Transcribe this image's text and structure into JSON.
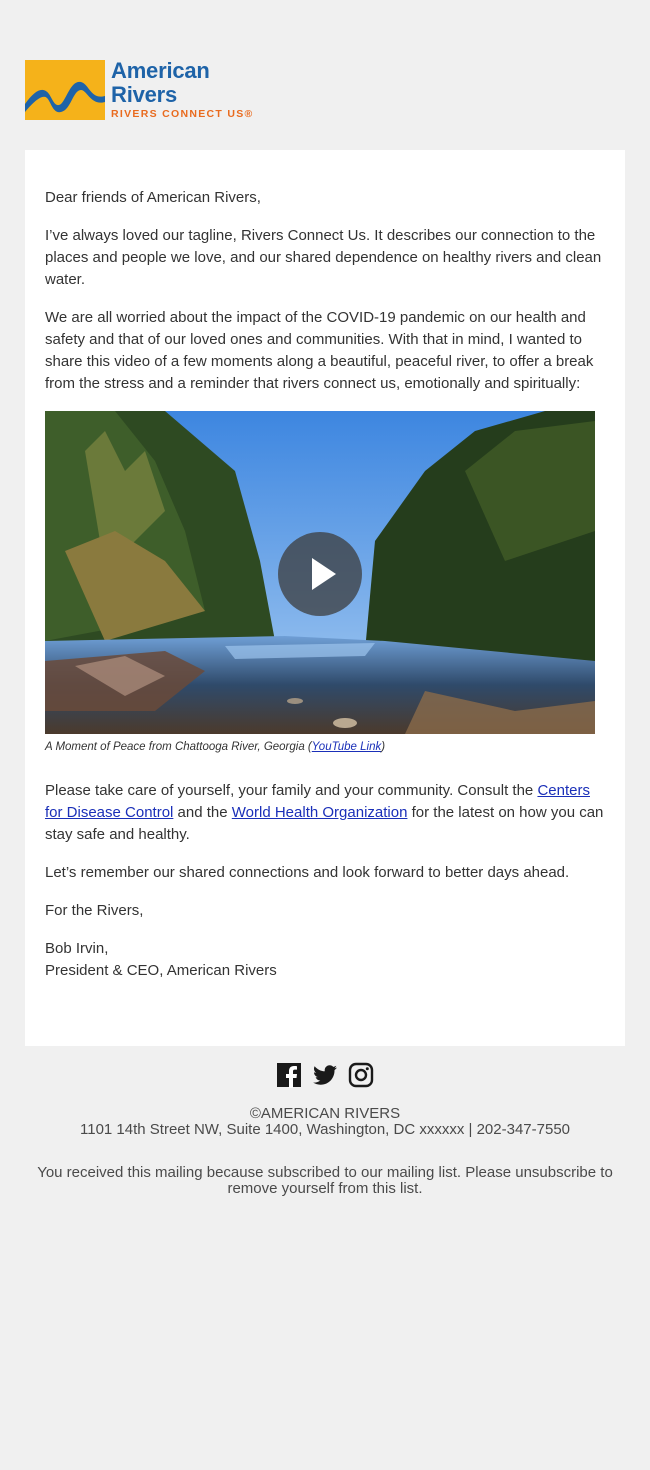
{
  "header": {
    "logo_title": "American Rivers",
    "logo_tagline": "RIVERS CONNECT US®"
  },
  "letter": {
    "greeting": "Dear friends of American Rivers,",
    "p1": "I’ve always loved our tagline, Rivers Connect Us. It describes our connection to the places and people we love, and our shared dependence on healthy rivers and clean water.",
    "p2": "We are all worried about the impact of the COVID-19 pandemic on our health and safety and that of our loved ones and communities. With that in mind, I wanted to share this video of a few moments along a beautiful, peaceful river, to offer a break from the stress and a reminder that rivers connect us, emotionally and spiritually:",
    "caption_text": "A Moment of Peace from Chattooga River, Georgia (",
    "caption_link": "YouTube Link",
    "caption_close": ")",
    "p3_a": "Please take care of yourself, your family and your community. Consult the ",
    "p3_link1": "Centers for Disease Control",
    "p3_b": " and the ",
    "p3_link2": "World Health Organization",
    "p3_c": " for the latest on how you can stay safe and healthy.",
    "p4": "Let’s remember our shared connections and look forward to better days ahead.",
    "p5": "For the Rivers,",
    "sig_name": "Bob Irvin,",
    "sig_title": "President & CEO, American Rivers"
  },
  "social": {
    "icons": [
      "facebook-icon",
      "twitter-icon",
      "instagram-icon"
    ]
  },
  "footer": {
    "copyright": "©AMERICAN RIVERS",
    "address": "1101 14th Street NW, Suite 1400, Washington, DC xxxxxx | 202-347-7550",
    "notice": "You received this mailing because subscribed to our mailing list. Please unsubscribe to remove yourself from this list."
  },
  "colors": {
    "page_bg": "#f0f0f0",
    "card_bg": "#ffffff",
    "link": "#1a2fb8",
    "brand_blue": "#1e63a8",
    "brand_orange": "#e96b1f",
    "logo_yellow": "#f5b21a"
  }
}
